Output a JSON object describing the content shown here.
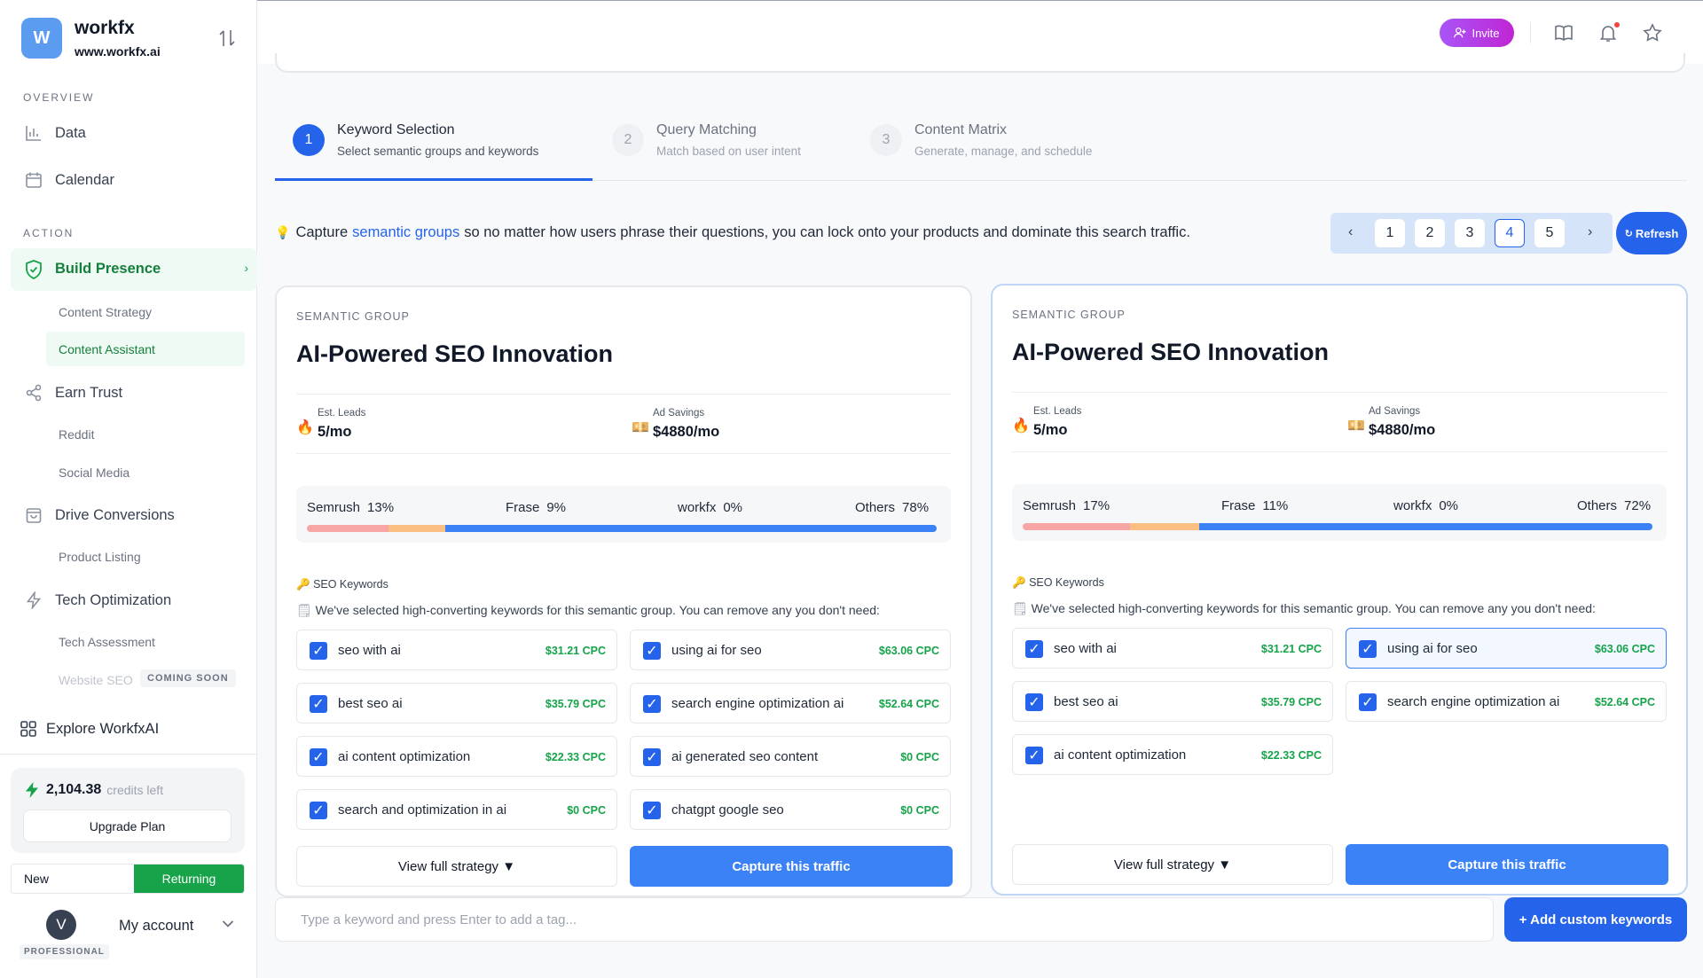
{
  "brand": {
    "logo_letter": "W",
    "name": "workfx",
    "url": "www.workfx.ai"
  },
  "sidebar": {
    "overview_label": "OVERVIEW",
    "data_label": "Data",
    "calendar_label": "Calendar",
    "action_label": "ACTION",
    "build_presence": "Build Presence",
    "content_strategy": "Content Strategy",
    "content_assistant": "Content Assistant",
    "earn_trust": "Earn Trust",
    "reddit": "Reddit",
    "social_media": "Social Media",
    "drive_conversions": "Drive Conversions",
    "product_listing": "Product Listing",
    "tech_optimization": "Tech Optimization",
    "tech_assessment": "Tech Assessment",
    "website_seo": "Website SEO",
    "coming_soon": "COMING SOON",
    "explore": "Explore WorkfxAI",
    "credits_value": "2,104.38",
    "credits_label": "credits left",
    "upgrade": "Upgrade Plan",
    "segment_new": "New",
    "segment_returning": "Returning",
    "avatar_letter": "V",
    "account": "My account",
    "plan": "PROFESSIONAL"
  },
  "topbar": {
    "invite": "Invite"
  },
  "steps": [
    {
      "num": "1",
      "title": "Keyword Selection",
      "subtitle": "Select semantic groups and keywords"
    },
    {
      "num": "2",
      "title": "Query Matching",
      "subtitle": "Match based on user intent"
    },
    {
      "num": "3",
      "title": "Content Matrix",
      "subtitle": "Generate, manage, and schedule"
    }
  ],
  "info": {
    "prefix": "Capture",
    "highlight": "semantic groups",
    "suffix": "so no matter how users phrase their questions, you can lock onto your products and dominate this search traffic."
  },
  "pagination": {
    "pages": [
      "1",
      "2",
      "3",
      "4",
      "5"
    ],
    "current": "4",
    "refresh": "Refresh"
  },
  "cards": [
    {
      "label": "SEMANTIC GROUP",
      "title": "AI-Powered SEO Innovation",
      "leads_label": "Est. Leads",
      "leads_value": "5/mo",
      "savings_label": "Ad Savings",
      "savings_value": "$4880/mo",
      "share": [
        {
          "name": "Semrush",
          "pct": "13%",
          "value": 13
        },
        {
          "name": "Frase",
          "pct": "9%",
          "value": 9
        },
        {
          "name": "workfx",
          "pct": "0%",
          "value": 0
        },
        {
          "name": "Others",
          "pct": "78%",
          "value": 78
        }
      ],
      "kw_heading": "SEO Keywords",
      "kw_desc": "We've selected high-converting keywords for this semantic group. You can remove any you don't need:",
      "keywords": [
        {
          "text": "seo with ai",
          "cpc": "$31.21 CPC"
        },
        {
          "text": "using ai for seo",
          "cpc": "$63.06 CPC"
        },
        {
          "text": "best seo ai",
          "cpc": "$35.79 CPC"
        },
        {
          "text": "search engine optimization ai",
          "cpc": "$52.64 CPC"
        },
        {
          "text": "ai content optimization",
          "cpc": "$22.33 CPC"
        },
        {
          "text": "ai generated seo content",
          "cpc": "$0 CPC"
        },
        {
          "text": "search and optimization in ai",
          "cpc": "$0 CPC"
        },
        {
          "text": "chatgpt google seo",
          "cpc": "$0 CPC"
        }
      ],
      "view": "View full strategy",
      "capture": "Capture this traffic"
    },
    {
      "label": "SEMANTIC GROUP",
      "title": "AI-Powered SEO Innovation",
      "leads_label": "Est. Leads",
      "leads_value": "5/mo",
      "savings_label": "Ad Savings",
      "savings_value": "$4880/mo",
      "share": [
        {
          "name": "Semrush",
          "pct": "17%",
          "value": 17
        },
        {
          "name": "Frase",
          "pct": "11%",
          "value": 11
        },
        {
          "name": "workfx",
          "pct": "0%",
          "value": 0
        },
        {
          "name": "Others",
          "pct": "72%",
          "value": 72
        }
      ],
      "kw_heading": "SEO Keywords",
      "kw_desc": "We've selected high-converting keywords for this semantic group. You can remove any you don't need:",
      "keywords": [
        {
          "text": "seo with ai",
          "cpc": "$31.21 CPC"
        },
        {
          "text": "using ai for seo",
          "cpc": "$63.06 CPC"
        },
        {
          "text": "best seo ai",
          "cpc": "$35.79 CPC"
        },
        {
          "text": "search engine optimization ai",
          "cpc": "$52.64 CPC"
        },
        {
          "text": "ai content optimization",
          "cpc": "$22.33 CPC"
        }
      ],
      "view": "View full strategy",
      "capture": "Capture this traffic"
    }
  ],
  "tag_input": {
    "placeholder": "Type a keyword and press Enter to add a tag..."
  },
  "add_custom": "+ Add custom keywords",
  "colors": {
    "primary": "#2563eb",
    "success": "#16a34a",
    "semrush": "#f8a5a5",
    "frase": "#fbbf84",
    "others": "#3b82f6"
  }
}
